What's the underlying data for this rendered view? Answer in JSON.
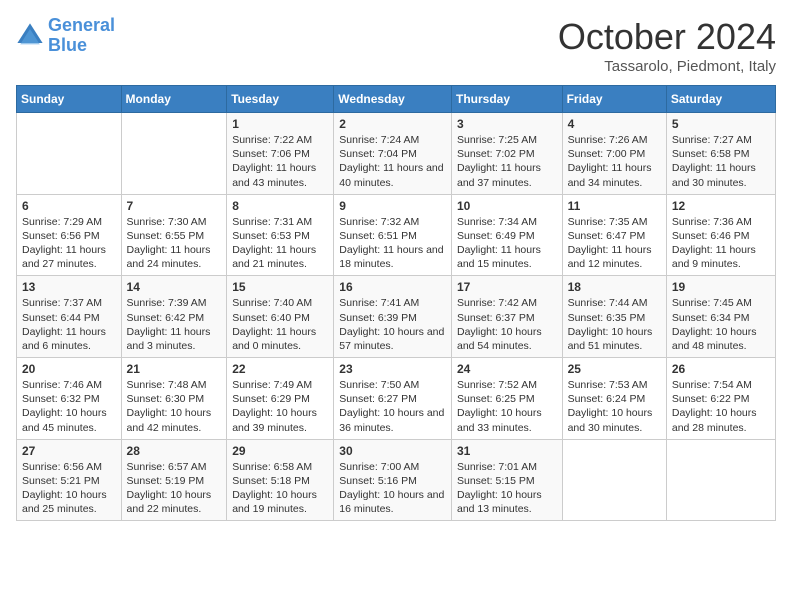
{
  "header": {
    "logo_line1": "General",
    "logo_line2": "Blue",
    "month_title": "October 2024",
    "subtitle": "Tassarolo, Piedmont, Italy"
  },
  "days_of_week": [
    "Sunday",
    "Monday",
    "Tuesday",
    "Wednesday",
    "Thursday",
    "Friday",
    "Saturday"
  ],
  "weeks": [
    [
      {
        "day": "",
        "sunrise": "",
        "sunset": "",
        "daylight": ""
      },
      {
        "day": "",
        "sunrise": "",
        "sunset": "",
        "daylight": ""
      },
      {
        "day": "1",
        "sunrise": "Sunrise: 7:22 AM",
        "sunset": "Sunset: 7:06 PM",
        "daylight": "Daylight: 11 hours and 43 minutes."
      },
      {
        "day": "2",
        "sunrise": "Sunrise: 7:24 AM",
        "sunset": "Sunset: 7:04 PM",
        "daylight": "Daylight: 11 hours and 40 minutes."
      },
      {
        "day": "3",
        "sunrise": "Sunrise: 7:25 AM",
        "sunset": "Sunset: 7:02 PM",
        "daylight": "Daylight: 11 hours and 37 minutes."
      },
      {
        "day": "4",
        "sunrise": "Sunrise: 7:26 AM",
        "sunset": "Sunset: 7:00 PM",
        "daylight": "Daylight: 11 hours and 34 minutes."
      },
      {
        "day": "5",
        "sunrise": "Sunrise: 7:27 AM",
        "sunset": "Sunset: 6:58 PM",
        "daylight": "Daylight: 11 hours and 30 minutes."
      }
    ],
    [
      {
        "day": "6",
        "sunrise": "Sunrise: 7:29 AM",
        "sunset": "Sunset: 6:56 PM",
        "daylight": "Daylight: 11 hours and 27 minutes."
      },
      {
        "day": "7",
        "sunrise": "Sunrise: 7:30 AM",
        "sunset": "Sunset: 6:55 PM",
        "daylight": "Daylight: 11 hours and 24 minutes."
      },
      {
        "day": "8",
        "sunrise": "Sunrise: 7:31 AM",
        "sunset": "Sunset: 6:53 PM",
        "daylight": "Daylight: 11 hours and 21 minutes."
      },
      {
        "day": "9",
        "sunrise": "Sunrise: 7:32 AM",
        "sunset": "Sunset: 6:51 PM",
        "daylight": "Daylight: 11 hours and 18 minutes."
      },
      {
        "day": "10",
        "sunrise": "Sunrise: 7:34 AM",
        "sunset": "Sunset: 6:49 PM",
        "daylight": "Daylight: 11 hours and 15 minutes."
      },
      {
        "day": "11",
        "sunrise": "Sunrise: 7:35 AM",
        "sunset": "Sunset: 6:47 PM",
        "daylight": "Daylight: 11 hours and 12 minutes."
      },
      {
        "day": "12",
        "sunrise": "Sunrise: 7:36 AM",
        "sunset": "Sunset: 6:46 PM",
        "daylight": "Daylight: 11 hours and 9 minutes."
      }
    ],
    [
      {
        "day": "13",
        "sunrise": "Sunrise: 7:37 AM",
        "sunset": "Sunset: 6:44 PM",
        "daylight": "Daylight: 11 hours and 6 minutes."
      },
      {
        "day": "14",
        "sunrise": "Sunrise: 7:39 AM",
        "sunset": "Sunset: 6:42 PM",
        "daylight": "Daylight: 11 hours and 3 minutes."
      },
      {
        "day": "15",
        "sunrise": "Sunrise: 7:40 AM",
        "sunset": "Sunset: 6:40 PM",
        "daylight": "Daylight: 11 hours and 0 minutes."
      },
      {
        "day": "16",
        "sunrise": "Sunrise: 7:41 AM",
        "sunset": "Sunset: 6:39 PM",
        "daylight": "Daylight: 10 hours and 57 minutes."
      },
      {
        "day": "17",
        "sunrise": "Sunrise: 7:42 AM",
        "sunset": "Sunset: 6:37 PM",
        "daylight": "Daylight: 10 hours and 54 minutes."
      },
      {
        "day": "18",
        "sunrise": "Sunrise: 7:44 AM",
        "sunset": "Sunset: 6:35 PM",
        "daylight": "Daylight: 10 hours and 51 minutes."
      },
      {
        "day": "19",
        "sunrise": "Sunrise: 7:45 AM",
        "sunset": "Sunset: 6:34 PM",
        "daylight": "Daylight: 10 hours and 48 minutes."
      }
    ],
    [
      {
        "day": "20",
        "sunrise": "Sunrise: 7:46 AM",
        "sunset": "Sunset: 6:32 PM",
        "daylight": "Daylight: 10 hours and 45 minutes."
      },
      {
        "day": "21",
        "sunrise": "Sunrise: 7:48 AM",
        "sunset": "Sunset: 6:30 PM",
        "daylight": "Daylight: 10 hours and 42 minutes."
      },
      {
        "day": "22",
        "sunrise": "Sunrise: 7:49 AM",
        "sunset": "Sunset: 6:29 PM",
        "daylight": "Daylight: 10 hours and 39 minutes."
      },
      {
        "day": "23",
        "sunrise": "Sunrise: 7:50 AM",
        "sunset": "Sunset: 6:27 PM",
        "daylight": "Daylight: 10 hours and 36 minutes."
      },
      {
        "day": "24",
        "sunrise": "Sunrise: 7:52 AM",
        "sunset": "Sunset: 6:25 PM",
        "daylight": "Daylight: 10 hours and 33 minutes."
      },
      {
        "day": "25",
        "sunrise": "Sunrise: 7:53 AM",
        "sunset": "Sunset: 6:24 PM",
        "daylight": "Daylight: 10 hours and 30 minutes."
      },
      {
        "day": "26",
        "sunrise": "Sunrise: 7:54 AM",
        "sunset": "Sunset: 6:22 PM",
        "daylight": "Daylight: 10 hours and 28 minutes."
      }
    ],
    [
      {
        "day": "27",
        "sunrise": "Sunrise: 6:56 AM",
        "sunset": "Sunset: 5:21 PM",
        "daylight": "Daylight: 10 hours and 25 minutes."
      },
      {
        "day": "28",
        "sunrise": "Sunrise: 6:57 AM",
        "sunset": "Sunset: 5:19 PM",
        "daylight": "Daylight: 10 hours and 22 minutes."
      },
      {
        "day": "29",
        "sunrise": "Sunrise: 6:58 AM",
        "sunset": "Sunset: 5:18 PM",
        "daylight": "Daylight: 10 hours and 19 minutes."
      },
      {
        "day": "30",
        "sunrise": "Sunrise: 7:00 AM",
        "sunset": "Sunset: 5:16 PM",
        "daylight": "Daylight: 10 hours and 16 minutes."
      },
      {
        "day": "31",
        "sunrise": "Sunrise: 7:01 AM",
        "sunset": "Sunset: 5:15 PM",
        "daylight": "Daylight: 10 hours and 13 minutes."
      },
      {
        "day": "",
        "sunrise": "",
        "sunset": "",
        "daylight": ""
      },
      {
        "day": "",
        "sunrise": "",
        "sunset": "",
        "daylight": ""
      }
    ]
  ]
}
